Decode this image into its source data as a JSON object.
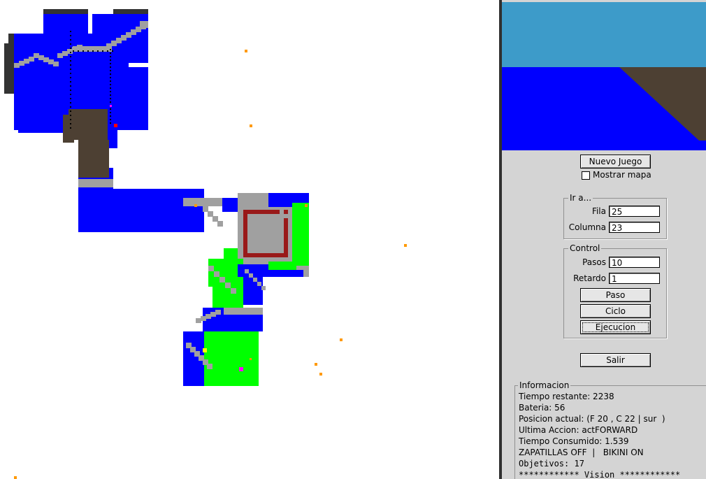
{
  "map": {
    "colors": {
      "water": "#0000ff",
      "stone": "#a0a0a0",
      "forest": "#00ff00",
      "mud": "#4d4033",
      "wall": "#991a1a",
      "cliff": "#333333",
      "item": "#ff9900",
      "agent": "#ff0000",
      "bikini": "#ff00ff",
      "zapatillas": "#ffff00",
      "path": "#000000"
    }
  },
  "view": {
    "sky_color": "#3d9bc9",
    "water_color": "#0000ff",
    "terrain_color": "#4d4033"
  },
  "controls": {
    "new_game_label": "Nuevo Juego",
    "show_map_label": "Mostrar mapa",
    "show_map_checked": false,
    "goto": {
      "legend": "Ir a...",
      "row_label": "Fila",
      "row_value": "25",
      "col_label": "Columna",
      "col_value": "23"
    },
    "control": {
      "legend": "Control",
      "steps_label": "Pasos",
      "steps_value": "10",
      "delay_label": "Retardo",
      "delay_value": "1",
      "step_button": "Paso",
      "cycle_button": "Ciclo",
      "run_button": "Ejecucion"
    },
    "exit_button": "Salir"
  },
  "info": {
    "legend": "Informacion",
    "time_left": "Tiempo restante: 2238",
    "battery": "Bateria: 56",
    "position": "Posicion actual: (F 20 , C 22 | sur  )",
    "last_action": "Ultima Accion: actFORWARD",
    "time_used": "Tiempo Consumido: 1.539",
    "equipment": "ZAPATILLAS OFF  |   BIKINI ON",
    "objectives": "Objetivos: 17",
    "vision": "************ Vision ************"
  }
}
